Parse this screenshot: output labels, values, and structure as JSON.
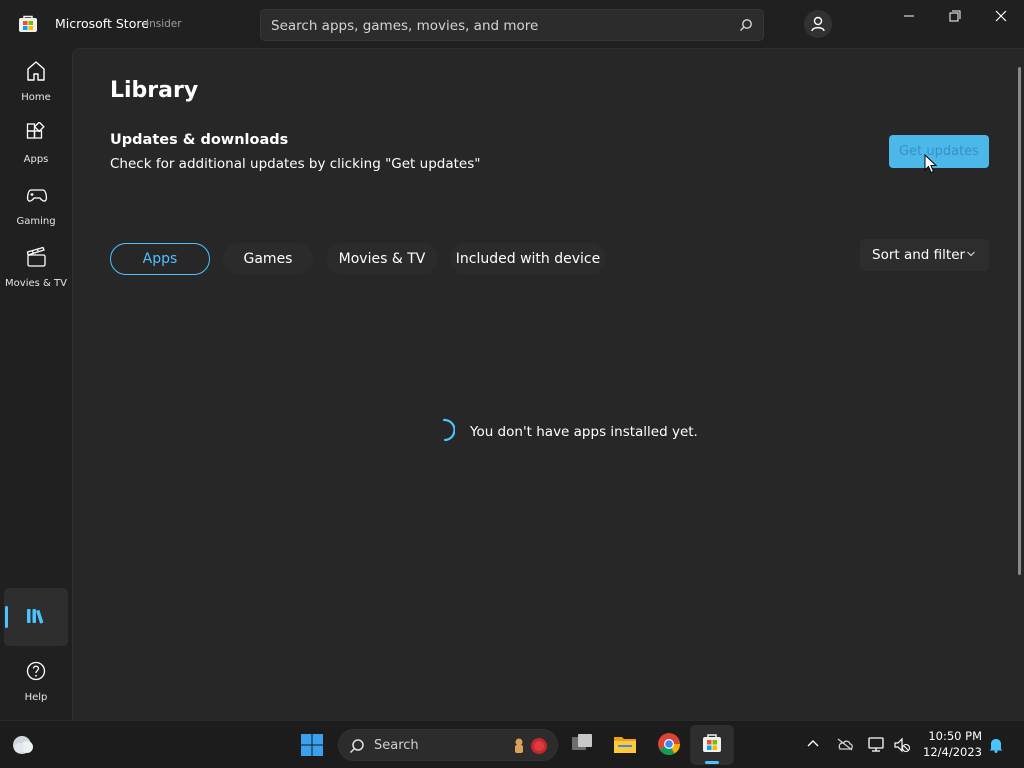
{
  "titlebar": {
    "app_title": "Microsoft Store",
    "app_badge": "Insider",
    "search_placeholder": "Search apps, games, movies, and more",
    "icons": [
      "store-logo-icon",
      "search-icon",
      "account-icon",
      "minimize-icon",
      "restore-icon",
      "close-icon"
    ]
  },
  "nav": {
    "items": [
      {
        "label": "Home",
        "icon": "home-icon"
      },
      {
        "label": "Apps",
        "icon": "apps-icon"
      },
      {
        "label": "Gaming",
        "icon": "gamepad-icon"
      },
      {
        "label": "Movies & TV",
        "icon": "clapperboard-icon"
      },
      {
        "label": "",
        "icon": "library-icon",
        "selected": true
      },
      {
        "label": "Help",
        "icon": "help-icon"
      }
    ]
  },
  "main": {
    "title": "Library",
    "updates": {
      "heading": "Updates & downloads",
      "description": "Check for additional updates by clicking \"Get updates\"",
      "button_label": "Get updates"
    },
    "tabs": [
      {
        "label": "Apps",
        "selected": true
      },
      {
        "label": "Games",
        "selected": false
      },
      {
        "label": "Movies & TV",
        "selected": false
      },
      {
        "label": "Included with device",
        "selected": false
      }
    ],
    "sort_filter_label": "Sort and filter",
    "empty_message": "You don't have apps installed yet."
  },
  "taskbar": {
    "search_label": "Search",
    "apps": [
      "windows-start-icon",
      "task-view-icon",
      "file-explorer-icon",
      "chrome-icon",
      "microsoft-store-icon"
    ],
    "tray_icons": [
      "show-hidden-icons-chevron",
      "onedrive-icon",
      "network-icon",
      "volume-muted-icon",
      "notification-bell-icon"
    ],
    "clock": {
      "time": "10:50 PM",
      "date": "12/4/2023"
    }
  },
  "colors": {
    "accent": "#4cc2ff",
    "button_fill": "#4cb8ea",
    "background": "#202020",
    "content_background": "#272727"
  }
}
